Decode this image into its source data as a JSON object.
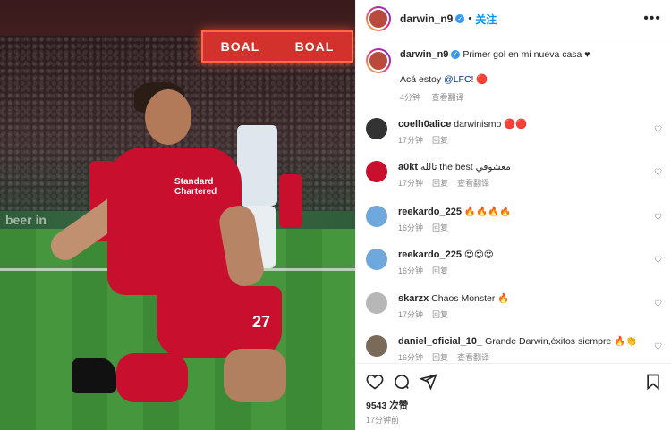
{
  "photo": {
    "banner_left": "BOAL",
    "banner_right": "BOAL",
    "board_text": "beer in",
    "sponsor_text": "Standard Chartered",
    "shirt_number": "27"
  },
  "header": {
    "username": "darwin_n9",
    "verified": true,
    "follow_label": "关注",
    "more_icon": "ellipsis-icon"
  },
  "caption": {
    "username": "darwin_n9",
    "text": "Primer gol en mi nueva casa ♥",
    "line2_prefix": "Acá estoy ",
    "line2_tag": "@LFC",
    "line2_suffix": "! 🔴",
    "time": "4分钟",
    "translate": "查看翻译"
  },
  "comments": [
    {
      "user": "coelh0alice",
      "text": "darwinismo 🔴🔴",
      "time": "17分钟",
      "reply": "回复",
      "translate": "",
      "avatar_color": "#333333"
    },
    {
      "user": "a0kt",
      "text": "تالله the best معشوقي",
      "time": "17分钟",
      "reply": "回复",
      "translate": "查看翻译",
      "avatar_color": "#c8102e"
    },
    {
      "user": "reekardo_225",
      "text": "🔥🔥🔥🔥",
      "time": "16分钟",
      "reply": "回复",
      "translate": "",
      "avatar_color": "#6fa8dc"
    },
    {
      "user": "reekardo_225",
      "text": "😍😍😍",
      "time": "16分钟",
      "reply": "回复",
      "translate": "",
      "avatar_color": "#6fa8dc"
    },
    {
      "user": "skarzx",
      "text": "Chaos Monster 🔥",
      "time": "17分钟",
      "reply": "回复",
      "translate": "",
      "avatar_color": "#b7b7b7"
    },
    {
      "user": "daniel_oficial_10_",
      "text": "Grande Darwin,éxitos siempre 🔥👏",
      "time": "16分钟",
      "reply": "回复",
      "translate": "查看翻译",
      "avatar_color": "#7a6a5a"
    }
  ],
  "actions": {
    "like_icon": "heart-icon",
    "comment_icon": "comment-icon",
    "share_icon": "share-icon",
    "save_icon": "bookmark-icon"
  },
  "likes": "9543 次赞",
  "posted": "17分钟前",
  "colors": {
    "accent": "#0095f6",
    "verified": "#3897f0",
    "liverpool_red": "#c8102e"
  }
}
